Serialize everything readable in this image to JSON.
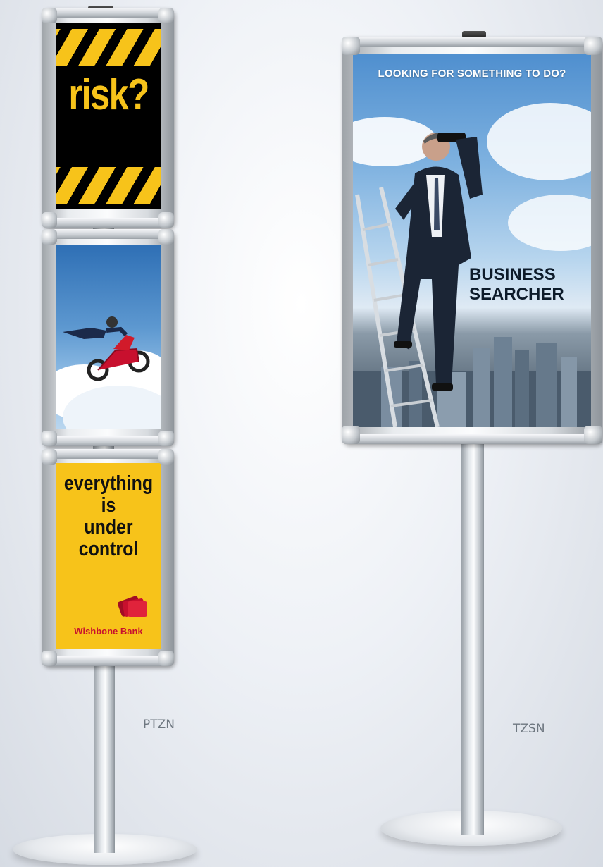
{
  "stands": [
    {
      "model": "PTZN",
      "posters": [
        {
          "text": "risk?",
          "theme": "hazard stripes",
          "colors": {
            "background": "#000000",
            "accent": "#f7c31a"
          }
        },
        {
          "text": "",
          "theme": "motocross rider on sky"
        },
        {
          "lines": [
            "everything",
            "is",
            "under",
            "control"
          ],
          "brand": "Wishbone Bank",
          "colors": {
            "background": "#f7c31a",
            "brand": "#c8102e"
          }
        }
      ]
    },
    {
      "model": "TZSN",
      "posters": [
        {
          "headline": "LOOKING FOR SOMETHING TO DO?",
          "title_line1": "BUSINESS",
          "title_line2": "SEARCHER",
          "theme": "businessman on ladder with binoculars above city"
        }
      ]
    }
  ]
}
